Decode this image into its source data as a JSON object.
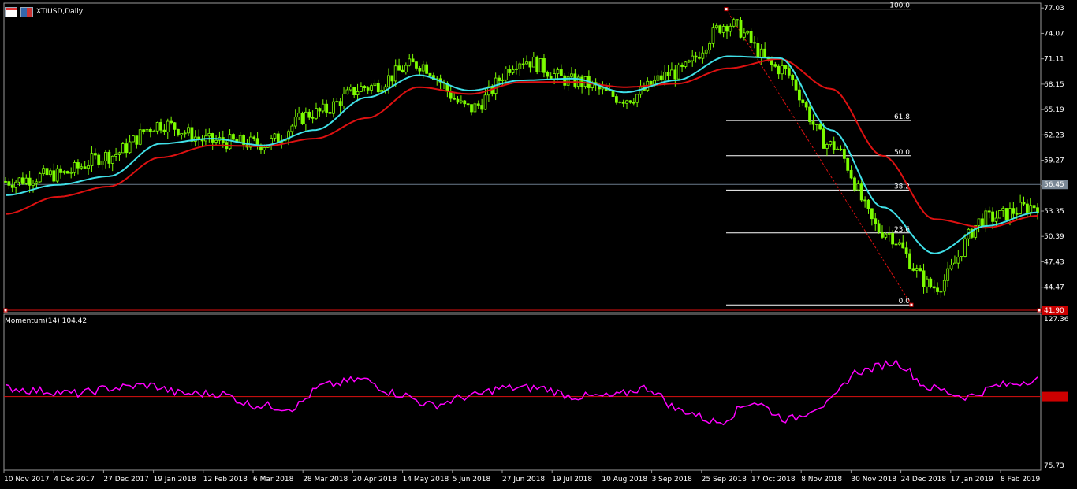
{
  "window": {
    "title": "XTIUSD,Daily",
    "indicator_title": "Momentum(14) 104.42"
  },
  "colors": {
    "background": "#000000",
    "bull_candle": "#7cfc00",
    "ma_fast": "#40e0e8",
    "ma_slow": "#dd1111",
    "momentum": "#ff00ff",
    "fib_lines": "#ffffff",
    "fib_trend": "#dd1111",
    "current_price_line": "#6a7b8c",
    "momentum_level": "#dd1111"
  },
  "price_axis": {
    "ticks": [
      "77.03",
      "74.07",
      "71.11",
      "68.15",
      "65.19",
      "62.23",
      "59.27",
      "56.31",
      "53.35",
      "50.39",
      "47.43",
      "44.47"
    ],
    "current_price": "56.45",
    "low_marker": "41.90",
    "range": [
      41.5,
      77.6
    ]
  },
  "momentum_axis": {
    "ticks": [
      "127.36",
      "100.00",
      "75.73"
    ],
    "range": [
      75.73,
      127.36
    ],
    "level": 100.0
  },
  "time_axis": {
    "labels": [
      "10 Nov 2017",
      "4 Dec 2017",
      "27 Dec 2017",
      "19 Jan 2018",
      "12 Feb 2018",
      "6 Mar 2018",
      "28 Mar 2018",
      "20 Apr 2018",
      "14 May 2018",
      "5 Jun 2018",
      "27 Jun 2018",
      "19 Jul 2018",
      "10 Aug 2018",
      "3 Sep 2018",
      "25 Sep 2018",
      "17 Oct 2018",
      "8 Nov 2018",
      "30 Nov 2018",
      "24 Dec 2018",
      "17 Jan 2019",
      "8 Feb 2019"
    ]
  },
  "fibonacci": {
    "levels": [
      {
        "label": "100.0",
        "price": 76.9
      },
      {
        "label": "61.8",
        "price": 63.9
      },
      {
        "label": "50.0",
        "price": 59.8
      },
      {
        "label": "38.2",
        "price": 55.8
      },
      {
        "label": "23.6",
        "price": 50.8
      },
      {
        "label": "0.0",
        "price": 42.4
      }
    ],
    "anchor_high": 76.9,
    "anchor_low": 42.4
  },
  "chart_data": {
    "type": "line",
    "title": "XTIUSD,Daily",
    "xlabel": "",
    "ylabel": "",
    "x": [
      "10 Nov 2017",
      "4 Dec 2017",
      "27 Dec 2017",
      "19 Jan 2018",
      "12 Feb 2018",
      "6 Mar 2018",
      "28 Mar 2018",
      "20 Apr 2018",
      "14 May 2018",
      "5 Jun 2018",
      "27 Jun 2018",
      "19 Jul 2018",
      "10 Aug 2018",
      "3 Sep 2018",
      "25 Sep 2018",
      "17 Oct 2018",
      "8 Nov 2018",
      "30 Nov 2018",
      "24 Dec 2018",
      "17 Jan 2019",
      "8 Feb 2019"
    ],
    "series": [
      {
        "type": "candles",
        "values": [
          56.8,
          57.6,
          59.8,
          63.5,
          61.5,
          61.2,
          64.8,
          67.8,
          70.5,
          65.3,
          71.0,
          68.5,
          66.5,
          69.5,
          75.2,
          70.0,
          61.0,
          51.0,
          44.5,
          52.5,
          54.0
        ]
      },
      {
        "type": "line",
        "values": [
          55.2,
          56.4,
          57.4,
          61.2,
          61.8,
          61.0,
          62.8,
          66.6,
          69.2,
          67.4,
          68.6,
          68.8,
          67.2,
          68.6,
          71.4,
          71.2,
          62.8,
          53.8,
          48.4,
          51.6,
          53.2
        ]
      },
      {
        "type": "line",
        "values": [
          53.0,
          55.0,
          56.2,
          59.6,
          61.0,
          60.9,
          61.8,
          64.2,
          67.8,
          67.0,
          68.4,
          68.4,
          67.8,
          68.2,
          70.0,
          71.1,
          67.6,
          59.8,
          52.4,
          51.4,
          52.8
        ]
      }
    ],
    "momentum": {
      "name": "Momentum(14)",
      "last": 104.42,
      "values": [
        103,
        102,
        101,
        103,
        104,
        101,
        101,
        97,
        96,
        104,
        106,
        101,
        97,
        100,
        103,
        103,
        100,
        100,
        103,
        95,
        91,
        98,
        92,
        97,
        109,
        112,
        103,
        100,
        104,
        106
      ]
    },
    "ylim": [
      41.5,
      77.6
    ]
  }
}
